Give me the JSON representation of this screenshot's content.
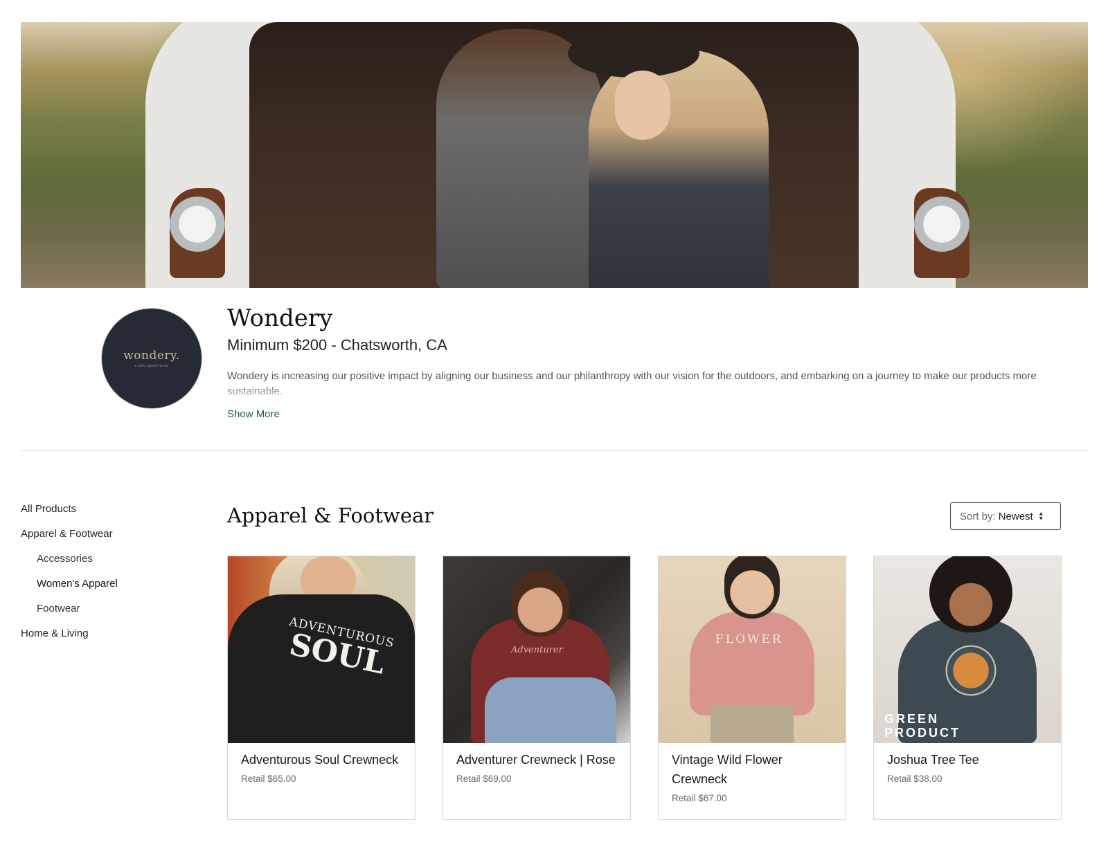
{
  "brand": {
    "logo_text": "wondery.",
    "logo_tagline": "a parks apparel brand",
    "name": "Wondery",
    "subtitle": "Minimum $200 - Chatsworth, CA",
    "description": "Wondery is increasing our positive impact by aligning our business and our philanthropy with our vision for the outdoors, and embarking on a journey to make our products more sustainable.",
    "show_more": "Show More"
  },
  "sidebar": {
    "items": [
      {
        "label": "All Products"
      },
      {
        "label": "Apparel & Footwear"
      },
      {
        "label": "Accessories"
      },
      {
        "label": "Women's Apparel"
      },
      {
        "label": "Footwear"
      },
      {
        "label": "Home & Living"
      }
    ]
  },
  "section": {
    "title": "Apparel & Footwear"
  },
  "sort": {
    "label": "Sort by:",
    "value": "Newest"
  },
  "products": [
    {
      "name": "Adventurous Soul Crewneck",
      "price": "Retail $65.00",
      "print_line1": "ADVENTUROUS",
      "print_line2": "SOUL"
    },
    {
      "name": "Adventurer Crewneck | Rose",
      "price": "Retail $69.00",
      "print": "Adventurer"
    },
    {
      "name": "Vintage Wild Flower Crewneck",
      "price": "Retail $67.00",
      "print": "FLOWER"
    },
    {
      "name": "Joshua Tree Tee",
      "price": "Retail $38.00",
      "badge_line1": "GREEN",
      "badge_line2": "PRODUCT"
    }
  ]
}
